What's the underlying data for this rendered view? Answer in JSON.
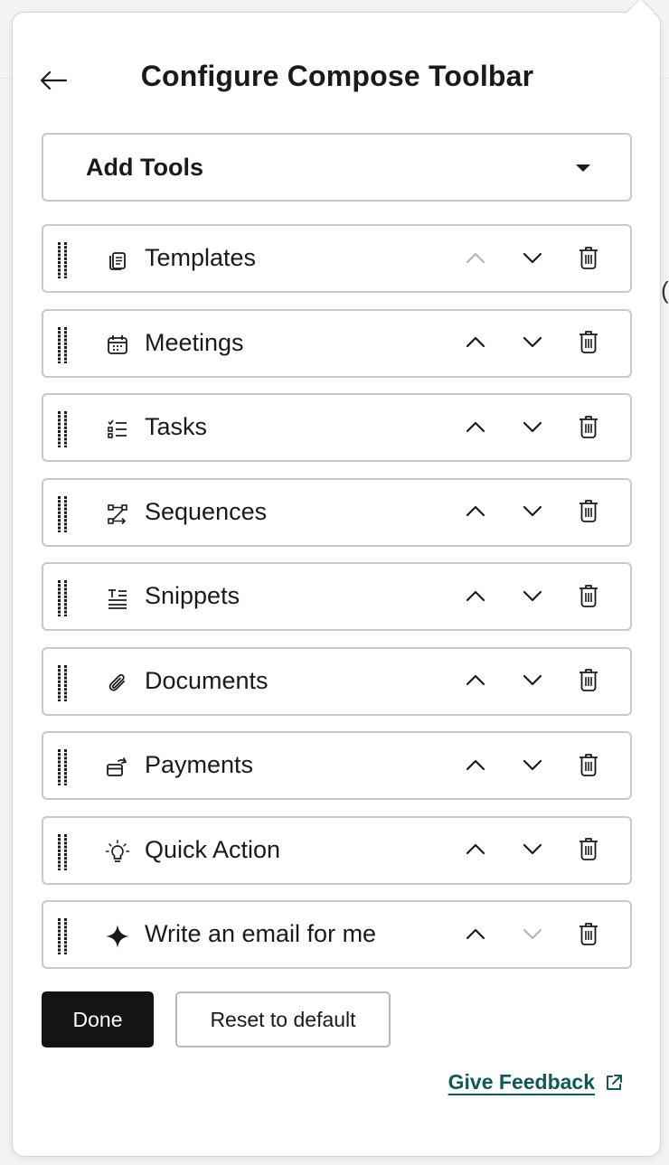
{
  "panel": {
    "title": "Configure Compose Toolbar"
  },
  "add_tools": {
    "label": "Add Tools"
  },
  "tools": [
    {
      "label": "Templates",
      "icon": "templates-icon",
      "up_disabled": true,
      "down_disabled": false
    },
    {
      "label": "Meetings",
      "icon": "calendar-icon",
      "up_disabled": false,
      "down_disabled": false
    },
    {
      "label": "Tasks",
      "icon": "checklist-icon",
      "up_disabled": false,
      "down_disabled": false
    },
    {
      "label": "Sequences",
      "icon": "sequence-icon",
      "up_disabled": false,
      "down_disabled": false
    },
    {
      "label": "Snippets",
      "icon": "snippet-icon",
      "up_disabled": false,
      "down_disabled": false
    },
    {
      "label": "Documents",
      "icon": "paperclip-icon",
      "up_disabled": false,
      "down_disabled": false
    },
    {
      "label": "Payments",
      "icon": "payment-card-icon",
      "up_disabled": false,
      "down_disabled": false
    },
    {
      "label": "Quick Action",
      "icon": "lightbulb-icon",
      "up_disabled": false,
      "down_disabled": false
    },
    {
      "label": "Write an email for me",
      "icon": "sparkle-icon",
      "up_disabled": false,
      "down_disabled": true
    }
  ],
  "buttons": {
    "done": "Done",
    "reset": "Reset to default"
  },
  "feedback": {
    "label": "Give Feedback"
  },
  "colors": {
    "primary_button": "#141414",
    "link": "#0c5c55",
    "border": "#c9c9c9",
    "disabled_icon": "#b5b5b5"
  }
}
